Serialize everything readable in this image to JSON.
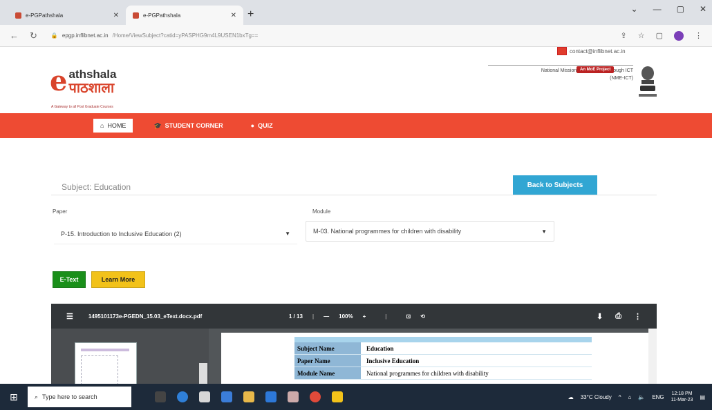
{
  "browser": {
    "tabs": [
      {
        "title": "e-PGPathshala"
      },
      {
        "title": "e-PGPathshala"
      }
    ],
    "url_host": "epgp.inflibnet.ac.in",
    "url_path": "/Home/ViewSubject?catid=yPASPHG9m4L9USEN1bxTg==",
    "window_controls": [
      "⌄",
      "—",
      "▢",
      "✕"
    ]
  },
  "site": {
    "logo_e": "e",
    "logo_line1": "athshala",
    "logo_line2": "पाठशाला",
    "tagline": "A Gateway to all Post Graduate Courses",
    "contact": "contact@inflibnet.ac.in",
    "badge": "An MoE Project",
    "mission_line1": "National Mission on Education through ICT",
    "mission_line2": "(NME-ICT)"
  },
  "nav": {
    "items": [
      {
        "label": "HOME",
        "icon": "home-icon"
      },
      {
        "label": "STUDENT CORNER",
        "icon": "graduation-cap-icon"
      },
      {
        "label": "QUIZ",
        "icon": "question-circle-icon"
      }
    ]
  },
  "main": {
    "subject_label": "Subject: Education",
    "back_button": "Back to Subjects",
    "paper_label": "Paper",
    "paper_value": "P-15. Introduction to Inclusive Education (2)",
    "module_label": "Module",
    "module_value": "M-03. National programmes for children with disability",
    "etext_button": "E-Text",
    "learn_more_button": "Learn More"
  },
  "pdf_viewer": {
    "filename": "1495101173e-PGEDN_15.03_eText.docx.pdf",
    "page_indicator": "1 / 13",
    "zoom": "100%",
    "zoom_out": "—",
    "zoom_in": "+",
    "doc_rows": [
      {
        "key": "Subject Name",
        "value": "Education"
      },
      {
        "key": "Paper Name",
        "value": "Inclusive Education"
      },
      {
        "key": "Module Name",
        "value": "National programmes for children with disability"
      }
    ]
  },
  "taskbar": {
    "search_placeholder": "Type here to search",
    "weather": "33°C Cloudy",
    "time": "12:18 PM",
    "date": "11-Mar-23",
    "lang": "ENG"
  },
  "colors": {
    "brand_red": "#ee4b33",
    "back_button": "#31a6d3",
    "etext_green": "#1a8f1a",
    "learn_yellow": "#f2c21a"
  }
}
